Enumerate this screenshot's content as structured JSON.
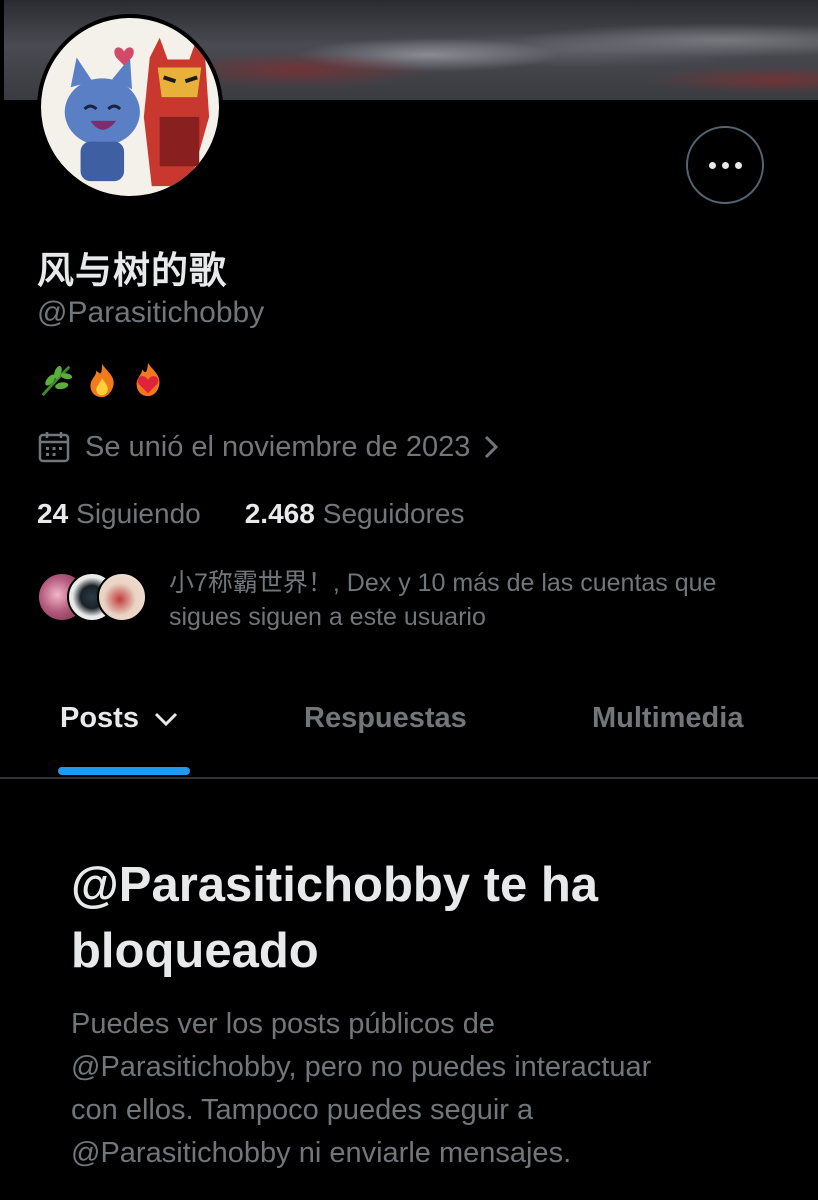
{
  "profile": {
    "display_name": "风与树的歌",
    "handle": "@Parasitichobby",
    "bio_emojis": [
      "herb-icon",
      "fire-icon",
      "heart-on-fire-icon"
    ],
    "joined": "Se unió el noviembre de 2023"
  },
  "stats": {
    "following_count": "24",
    "following_label": "Siguiendo",
    "followers_count": "2.468",
    "followers_label": "Seguidores"
  },
  "known_followers": {
    "text_line1": "小7称霸世界！, Dex y 10 más de las cuentas que",
    "text_line2": "sigues siguen a este usuario"
  },
  "tabs": [
    {
      "label": "Posts",
      "active": true
    },
    {
      "label": "Respuestas",
      "active": false
    },
    {
      "label": "Multimedia",
      "active": false
    }
  ],
  "blocked": {
    "title_line1": "@Parasitichobby te ha",
    "title_line2": "bloqueado",
    "desc_line1": "Puedes ver los posts públicos de",
    "desc_line2": "@Parasitichobby, pero no puedes interactuar",
    "desc_line3": "con ellos. Tampoco puedes seguir a",
    "desc_line4": "@Parasitichobby ni enviarle mensajes."
  },
  "colors": {
    "background": "#000000",
    "primary_text": "#e7e9ea",
    "secondary_text": "#71767b",
    "accent": "#1d9bf0",
    "divider": "#2f3336"
  }
}
